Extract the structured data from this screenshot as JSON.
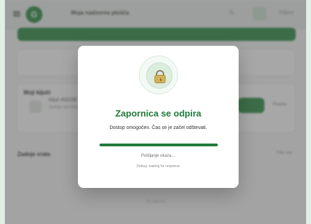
{
  "header": {
    "app_title": "Moja nadzorna plošča",
    "lang_label": "SL",
    "logout_label": "Odjava"
  },
  "devices": {
    "section_title": "Moji ključi",
    "item": {
      "name": "Ključ 4SGSB",
      "sub": "Zadnja uporaba: —",
      "action_label": "Odpri",
      "secondary_label": "Pravice"
    }
  },
  "history": {
    "title": "Zadnje vrata",
    "filter_label": "Filtri vse",
    "empty": "Ni zapisov"
  },
  "modal": {
    "title": "Zapornica se odpira",
    "description": "Dostop omogočen. Čas se je začel odštevati.",
    "progress": 1.0,
    "status": "Pošiljanje ukaza…",
    "debug": "Debug: waiting for response"
  },
  "colors": {
    "accent": "#1f7a3a",
    "overlay": "rgba(0,0,0,0.34)"
  },
  "icons": {
    "menu": "hamburger-icon",
    "logo": "brand-logo-icon",
    "lock": "lock-icon"
  }
}
